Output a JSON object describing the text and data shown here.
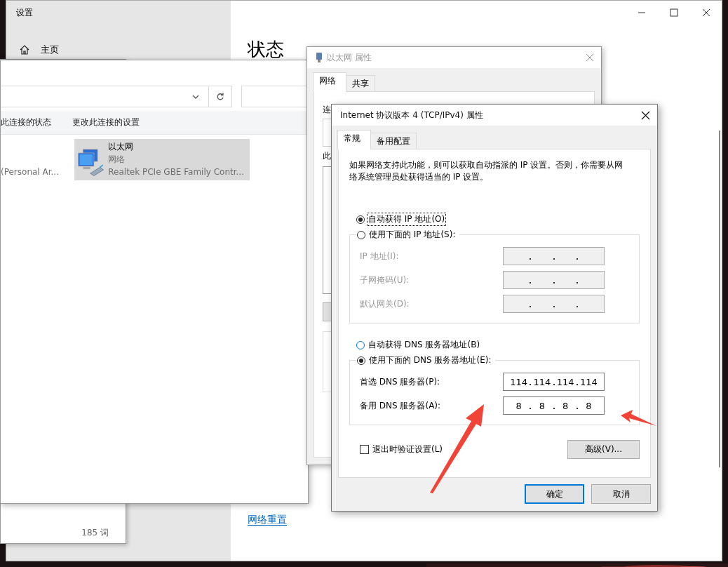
{
  "settings_window": {
    "title": "设置",
    "nav": [
      {
        "label": "主页"
      }
    ],
    "heading": "状态",
    "link": "网络重置"
  },
  "background_window": {
    "word_count": "185 词"
  },
  "connections_window": {
    "commands": [
      "此连接的状态",
      "更改此连接的设置"
    ],
    "items": [
      {
        "device": "(Personal Ar...",
        "selected": false
      },
      {
        "name": "以太网",
        "type": "网络",
        "device": "Realtek PCIe GBE Family Contr...",
        "selected": true
      }
    ]
  },
  "ethernet_window": {
    "title": "以太网 属性",
    "active": false,
    "tabs": [
      {
        "label": "网络",
        "selected": true
      },
      {
        "label": "共享",
        "selected": false
      }
    ],
    "labels": [
      "连",
      "此"
    ]
  },
  "ipv4_dialog": {
    "title": "Internet 协议版本 4 (TCP/IPv4) 属性",
    "tabs": [
      {
        "label": "常规",
        "selected": true
      },
      {
        "label": "备用配置",
        "selected": false
      }
    ],
    "description": "如果网络支持此功能，则可以获取自动指派的 IP 设置。否则，你需要从网络系统管理员处获得适当的 IP 设置。",
    "ip_mode": [
      {
        "label": "自动获得 IP 地址(O)",
        "selected": true
      },
      {
        "label": "使用下面的 IP 地址(S):",
        "selected": false
      }
    ],
    "ip_fields": [
      {
        "label": "IP 地址(I):"
      },
      {
        "label": "子网掩码(U):"
      },
      {
        "label": "默认网关(D):"
      }
    ],
    "ip_fields_disabled": true,
    "dns_mode": [
      {
        "label": "自动获得 DNS 服务器地址(B)",
        "selected": false
      },
      {
        "label": "使用下面的 DNS 服务器地址(E):",
        "selected": true
      }
    ],
    "dns_fields": [
      {
        "label": "首选 DNS 服务器(P):",
        "octets": [
          "114",
          "114",
          "114",
          "114"
        ]
      },
      {
        "label": "备用 DNS 服务器(A):",
        "octets": [
          "8",
          "8",
          "8",
          "8"
        ]
      }
    ],
    "validate": {
      "label": "退出时验证设置(L)",
      "checked": false
    },
    "advanced_button": "高级(V)...",
    "buttons": [
      {
        "label": "确定",
        "default": true
      },
      {
        "label": "取消",
        "default": false
      }
    ]
  }
}
